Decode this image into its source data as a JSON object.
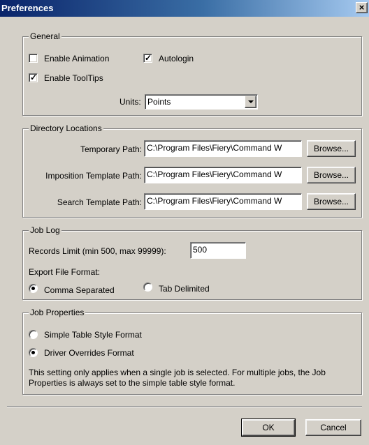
{
  "window": {
    "title": "Preferences",
    "close_glyph": "×"
  },
  "general": {
    "legend": "General",
    "enable_animation": {
      "label": "Enable Animation",
      "checked": false
    },
    "autologin": {
      "label": "Autologin",
      "checked": true
    },
    "enable_tooltips": {
      "label": "Enable ToolTips",
      "checked": true
    },
    "units_label": "Units:",
    "units_value": "Points"
  },
  "directories": {
    "legend": "Directory Locations",
    "rows": [
      {
        "label": "Temporary Path:",
        "value": "C:\\Program Files\\Fiery\\Command W",
        "button": "Browse..."
      },
      {
        "label": "Imposition Template Path:",
        "value": "C:\\Program Files\\Fiery\\Command W",
        "button": "Browse..."
      },
      {
        "label": "Search Template Path:",
        "value": "C:\\Program Files\\Fiery\\Command W",
        "button": "Browse..."
      }
    ]
  },
  "job_log": {
    "legend": "Job Log",
    "records_label": "Records Limit (min 500, max 99999):",
    "records_value": "500",
    "export_label": "Export File Format:",
    "comma": {
      "label": "Comma Separated",
      "selected": true
    },
    "tab": {
      "label": "Tab Delimited",
      "selected": false
    }
  },
  "job_properties": {
    "legend": "Job Properties",
    "simple": {
      "label": "Simple Table Style Format",
      "selected": false
    },
    "driver": {
      "label": "Driver Overrides Format",
      "selected": true
    },
    "note": "This setting only applies when a single job is selected. For multiple jobs, the Job Properties is always set to the simple table style format."
  },
  "footer": {
    "ok": "OK",
    "cancel": "Cancel"
  },
  "colors": {
    "title_start": "#0a246a",
    "title_end": "#a6caf0",
    "face": "#d4d0c8"
  },
  "icons": {
    "close": "close-icon",
    "check": "checkmark-icon",
    "dropdown": "chevron-down-icon"
  }
}
